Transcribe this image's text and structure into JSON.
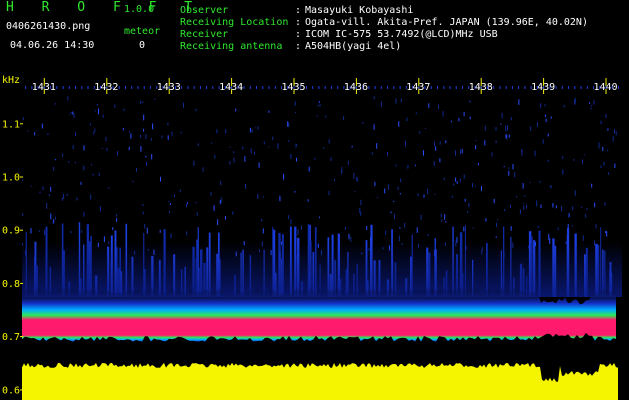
{
  "app": {
    "name": "H R O F F T",
    "version": "1.0.0"
  },
  "file": {
    "name": "0406261430.png",
    "datetime": "04.06.26 14:30"
  },
  "meteor": {
    "label": "meteor",
    "count": "0"
  },
  "info": [
    {
      "label": "Observer",
      "sep": ":",
      "value": "Masayuki Kobayashi"
    },
    {
      "label": "Receiving Location",
      "sep": ":",
      "value": "Ogata-vill. Akita-Pref. JAPAN (139.96E, 40.02N)"
    },
    {
      "label": "Receiver",
      "sep": ":",
      "value": "ICOM IC-575 53.7492(@LCD)MHz USB"
    },
    {
      "label": "Receiving antenna",
      "sep": ":",
      "value": "A504HB(yagi 4el)"
    }
  ],
  "chart_data": {
    "type": "heatmap",
    "ylabel": "kHz",
    "y_ticks": [
      "1.1",
      "1.0",
      "0.9",
      "0.8",
      "0.7",
      "0.6"
    ],
    "x_ticks": [
      "1431",
      "1432",
      "1433",
      "1434",
      "1435",
      "1436",
      "1437",
      "1438",
      "1439",
      "1440"
    ],
    "y_range": [
      0.58,
      1.17
    ],
    "x_range": [
      1430.65,
      1440.2
    ],
    "grid": false
  },
  "colors": {
    "header_label": "#2fe82f",
    "header_value": "#ffffff",
    "axis_text": "#f5f500",
    "band_core": "#ff1a6e",
    "noise_floor": "#f5f500"
  }
}
